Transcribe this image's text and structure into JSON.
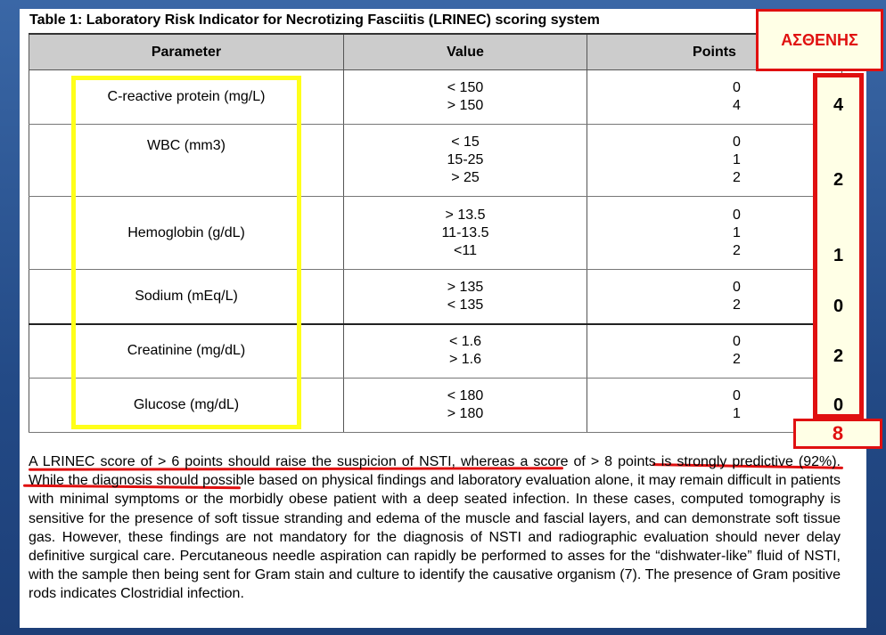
{
  "title": "Table 1: Laboratory Risk Indicator for Necrotizing Fasciitis (LRINEC) scoring system",
  "headers": {
    "parameter": "Parameter",
    "value": "Value",
    "points": "Points"
  },
  "rows": [
    {
      "parameter": "C-reactive protein (mg/L)",
      "values": [
        "< 150",
        "> 150"
      ],
      "points": [
        "0",
        "4"
      ]
    },
    {
      "parameter": "WBC (mm3)",
      "values": [
        "< 15",
        "15-25",
        "> 25"
      ],
      "points": [
        "0",
        "1",
        "2"
      ]
    },
    {
      "parameter": "Hemoglobin (g/dL)",
      "values": [
        "> 13.5",
        "11-13.5",
        "<11"
      ],
      "points": [
        "0",
        "1",
        "2"
      ]
    },
    {
      "parameter": "Sodium (mEq/L)",
      "values": [
        "> 135",
        "< 135"
      ],
      "points": [
        "0",
        "2"
      ]
    },
    {
      "parameter": "Creatinine (mg/dL)",
      "values": [
        "< 1.6",
        "> 1.6"
      ],
      "points": [
        "0",
        "2"
      ]
    },
    {
      "parameter": "Glucose (mg/dL)",
      "values": [
        "< 180",
        "> 180"
      ],
      "points": [
        "0",
        "1"
      ]
    }
  ],
  "patient": {
    "header": "ΑΣΘΕΝΗΣ",
    "scores": [
      "4",
      "2",
      "1",
      "0",
      "2",
      "0"
    ],
    "total": "8"
  },
  "colors": {
    "highlight_yellow": "#ffff1a",
    "annotation_red": "#e01010"
  },
  "paragraph": "A LRINEC score of > 6 points should raise the suspicion of NSTI, whereas a score of > 8 points is strongly predictive (92%). While the diagnosis should possible based on physical findings and laboratory evaluation alone, it may remain difficult in patients with minimal symptoms or the morbidly obese patient with a deep seated infection. In these cases, computed tomography is sensitive for the presence of soft tissue stranding and edema of the muscle and fascial layers, and can demonstrate soft tissue gas. However, these findings are not mandatory for the diagnosis of NSTI and radiographic evaluation should never delay definitive surgical care. Percutaneous needle aspiration can rapidly be performed to asses for the “dishwater-like” fluid of NSTI, with the sample then being sent for Gram stain and culture to identify the causative organism (7). The presence of Gram positive rods indicates Clostridial infection."
}
